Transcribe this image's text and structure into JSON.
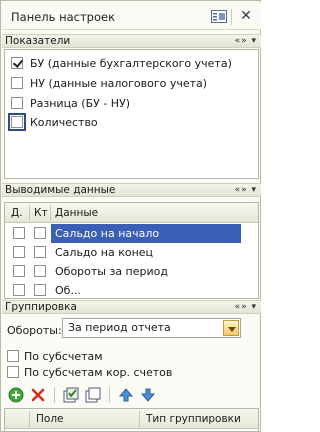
{
  "panel": {
    "title": "Панель настроек"
  },
  "sections": {
    "indicators": {
      "title": "Показатели",
      "controls": "«» ▾"
    },
    "output": {
      "title": "Выводимые данные",
      "controls": "«» ▾"
    },
    "grouping": {
      "title": "Группировка",
      "controls": "«» ▾"
    }
  },
  "indicators": [
    {
      "label": "БУ (данные бухгалтерского учета)",
      "checked": true
    },
    {
      "label": "НУ (данные налогового учета)",
      "checked": false
    },
    {
      "label": "Разница (БУ - НУ)",
      "checked": false
    },
    {
      "label": "Количество",
      "checked": false
    }
  ],
  "output_table": {
    "columns": [
      "Д.",
      "Кт",
      "Данные"
    ],
    "rows": [
      "Сальдо на начало",
      "Сальдо на конец",
      "Обороты за период",
      "Об..."
    ],
    "selected_index": 0
  },
  "grouping": {
    "field_label": "Обороты:",
    "field_value": "За период отчета",
    "options": [
      "По субсчетам",
      "По субсчетам кор. счетов"
    ],
    "table_columns": [
      "Поле",
      "Тип группировки"
    ]
  },
  "colors": {
    "selection": "#3b5fb4",
    "accent": "#f3c969"
  }
}
